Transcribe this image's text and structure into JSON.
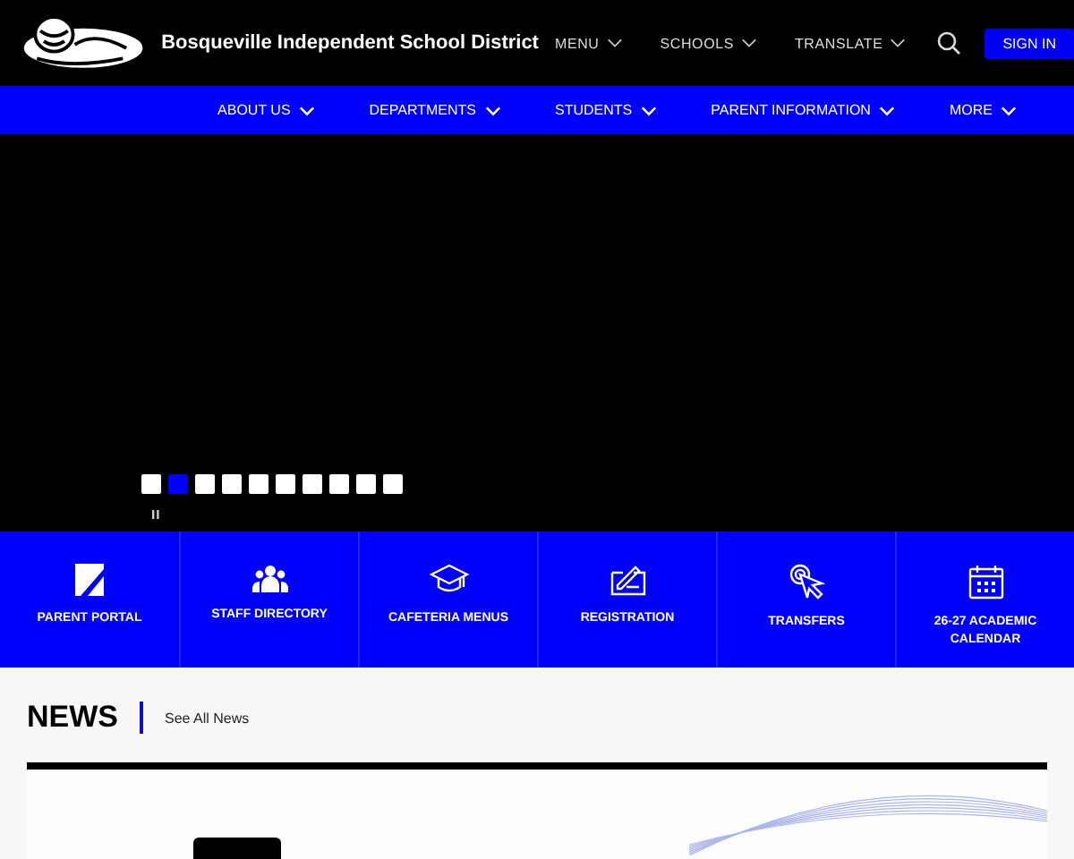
{
  "header": {
    "title": "Bosqueville Independent School District",
    "menus": [
      {
        "label": "MENU"
      },
      {
        "label": "SCHOOLS"
      },
      {
        "label": "TRANSLATE"
      }
    ],
    "sign_in": "SIGN IN"
  },
  "nav": [
    {
      "label": "ABOUT US"
    },
    {
      "label": "DEPARTMENTS"
    },
    {
      "label": "STUDENTS"
    },
    {
      "label": "PARENT INFORMATION"
    },
    {
      "label": "MORE"
    }
  ],
  "carousel": {
    "dots": [
      {
        "selected": false
      },
      {
        "selected": true
      },
      {
        "selected": false
      },
      {
        "selected": false
      },
      {
        "selected": false
      },
      {
        "selected": false
      },
      {
        "selected": false
      },
      {
        "selected": false
      },
      {
        "selected": false
      },
      {
        "selected": false
      }
    ]
  },
  "quick_links": [
    {
      "kind": "portal",
      "label": "PARENT PORTAL"
    },
    {
      "kind": "people",
      "label": "STAFF DIRECTORY"
    },
    {
      "kind": "cap",
      "label": "CAFETERIA MENUS"
    },
    {
      "kind": "form",
      "label": "REGISTRATION"
    },
    {
      "kind": "click",
      "label": "TRANSFERS"
    },
    {
      "kind": "calendar",
      "label": "26-27 ACADEMIC CALENDAR"
    }
  ],
  "news": {
    "title": "NEWS",
    "link": "See All News"
  }
}
